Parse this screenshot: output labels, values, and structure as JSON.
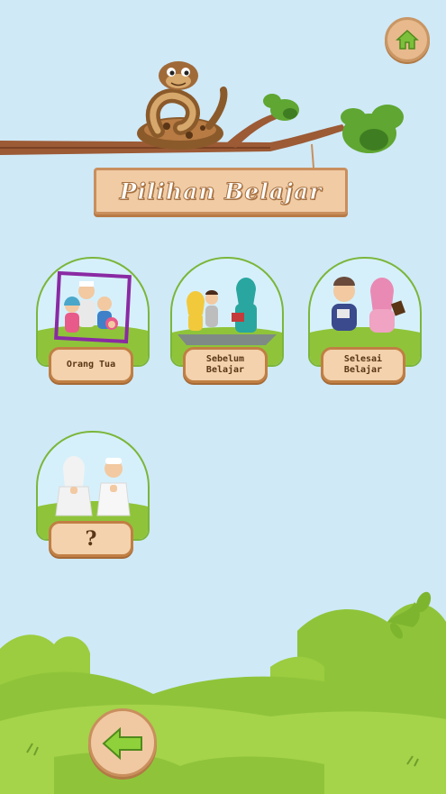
{
  "header": {
    "title": "Pilihan Belajar"
  },
  "menu": {
    "items": [
      {
        "label": "Orang Tua"
      },
      {
        "label": "Sebelum\nBelajar"
      },
      {
        "label": "Selesai\nBelajar"
      },
      {
        "label": "?"
      }
    ]
  },
  "icons": {
    "home": "home-icon",
    "back": "arrow-left-icon",
    "mascot": "snake-illustration"
  },
  "colors": {
    "sky": "#cfe9f7",
    "grass": "#8fc43a",
    "wood": "#c17f44",
    "button_fill": "#f3d2ad"
  }
}
